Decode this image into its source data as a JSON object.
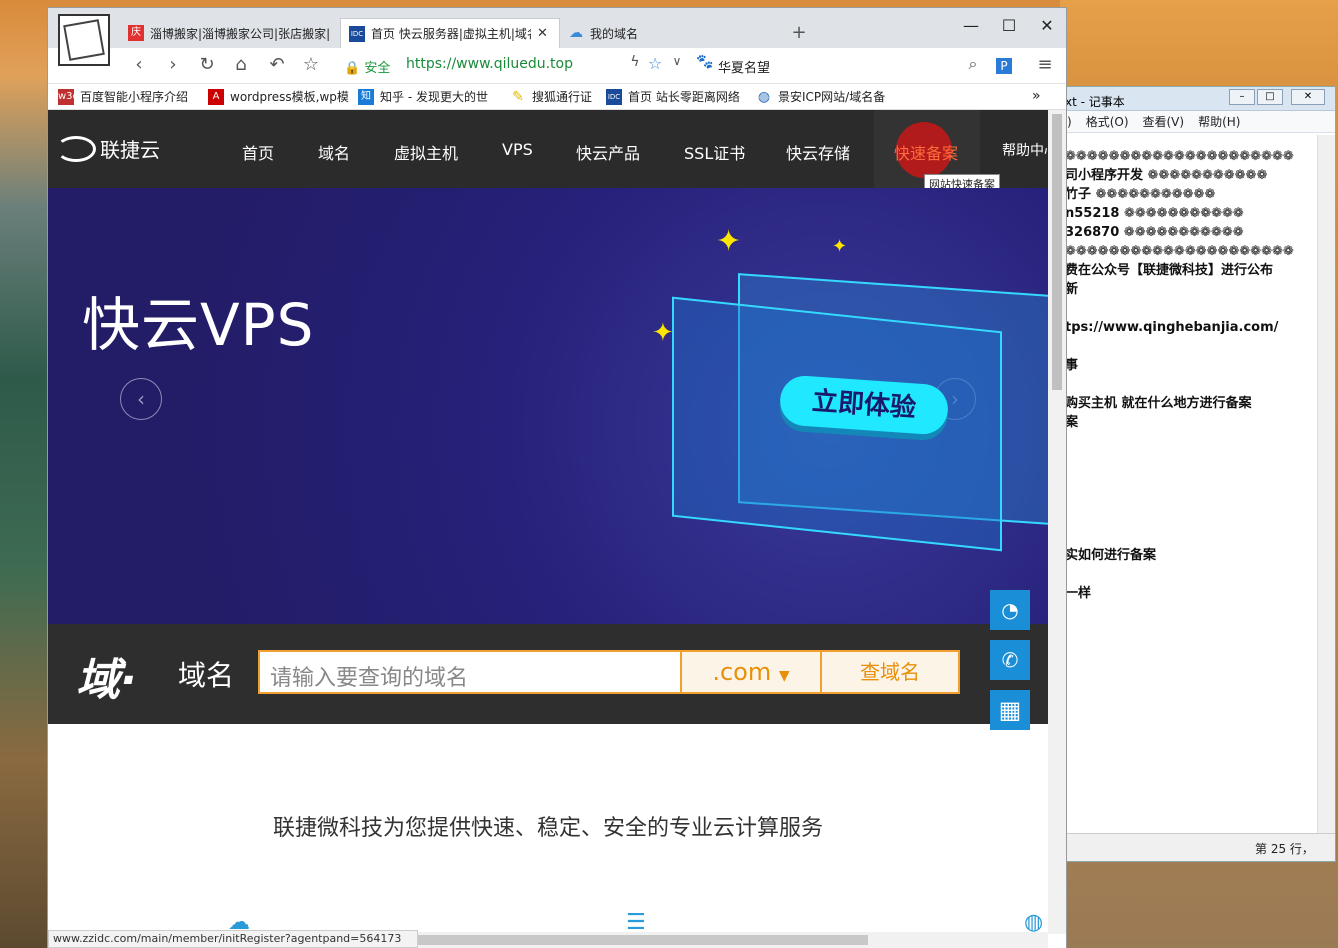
{
  "browser": {
    "tabs": [
      {
        "label": "淄博搬家|淄博搬家公司|张店搬家|",
        "icon": "庆"
      },
      {
        "label": "首页 快云服务器|虚拟主机|域名",
        "icon": "IDC"
      },
      {
        "label": "我的域名",
        "icon": "cloud-icon"
      }
    ],
    "new_tab": "+",
    "secure_label": "安全",
    "url": "https://www.qiluedu.top",
    "site_name": "华夏名望",
    "bookmarks": [
      {
        "label": "百度智能小程序介绍",
        "icon": "w3c"
      },
      {
        "label": "wordpress模板,wp模",
        "icon": "A"
      },
      {
        "label": "知乎 - 发现更大的世",
        "icon": "知"
      },
      {
        "label": "搜狐通行证",
        "icon": "feather"
      },
      {
        "label": "首页 站长零距离网络",
        "icon": "IDC"
      },
      {
        "label": "景安ICP网站/域名备",
        "icon": "globe"
      }
    ],
    "bookmarks_more": "»",
    "status_url": "www.zzidc.com/main/member/initRegister?agentpand=564173"
  },
  "site": {
    "brand": "联捷云",
    "nav": [
      "首页",
      "域名",
      "虚拟主机",
      "VPS",
      "快云产品",
      "SSL证书",
      "快云存储",
      "快速备案",
      "帮助中心"
    ],
    "tooltip": "网站快速备案",
    "banner_title": "快云VPS",
    "banner_cta": "立即体验",
    "domain_label": "域名",
    "domain_placeholder": "请输入要查询的域名",
    "domain_suffix": ".com",
    "domain_button": "查域名",
    "tagline": "联捷微科技为您提供快速、稳定、安全的专业云计算服务"
  },
  "notepad": {
    "title": "xt - 记事本",
    "menu": [
      ")",
      "格式(O)",
      "查看(V)",
      "帮助(H)"
    ],
    "lines": [
      "❁❁❁❁❁❁❁❁❁❁❁❁❁❁❁❁❁❁❁❁❁",
      "司小程序开发 ❁❁❁❁❁❁❁❁❁❁❁",
      "竹子        ❁❁❁❁❁❁❁❁❁❁❁",
      "n55218      ❁❁❁❁❁❁❁❁❁❁❁",
      "326870      ❁❁❁❁❁❁❁❁❁❁❁",
      "❁❁❁❁❁❁❁❁❁❁❁❁❁❁❁❁❁❁❁❁❁",
      "费在公众号【联捷微科技】进行公布",
      "新",
      "",
      "tps://www.qinghebanjia.com/",
      "",
      "事",
      "",
      "购买主机 就在什么地方进行备案",
      "案",
      "",
      "",
      "",
      "",
      "",
      "",
      "实如何进行备案",
      "",
      "一样"
    ],
    "status": "第 25 行，"
  }
}
